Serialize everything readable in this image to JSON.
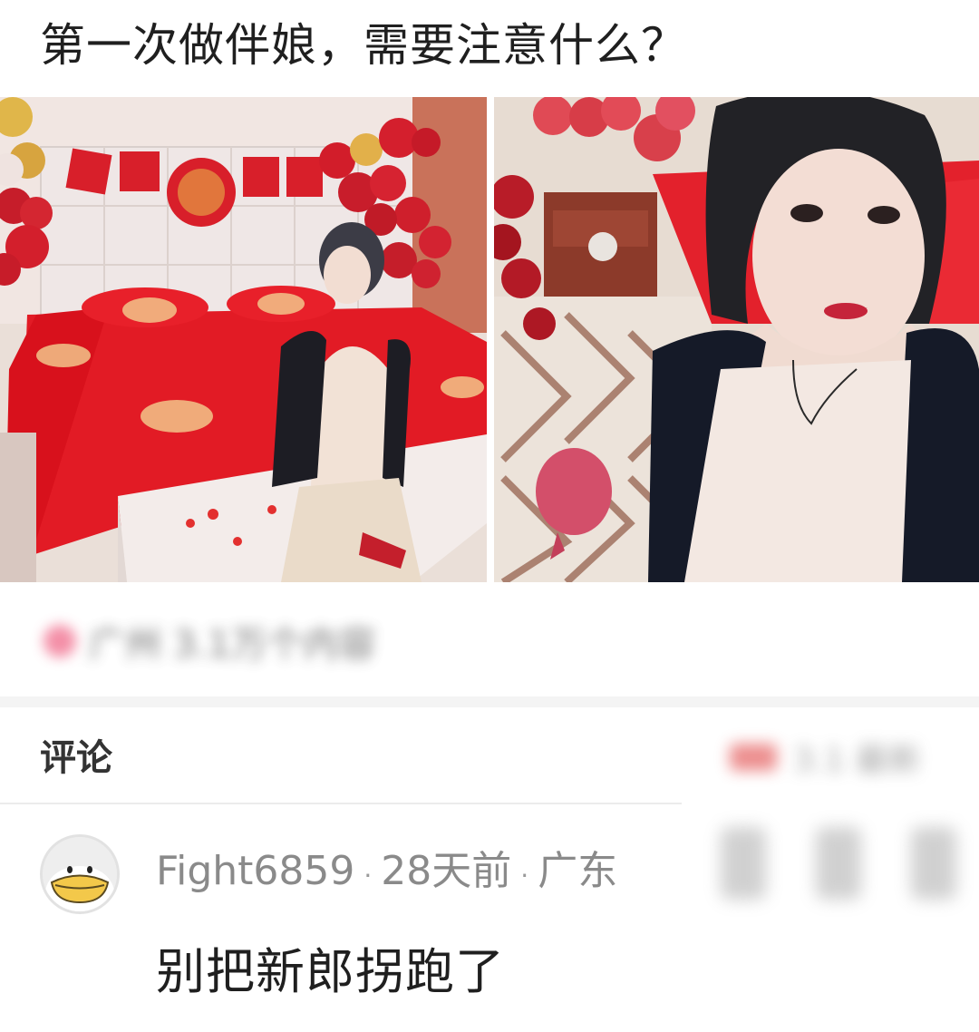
{
  "post": {
    "title": "第一次做伴娘，需要注意什么？"
  },
  "location": {
    "text": "广州 3.1万个内容"
  },
  "comments": {
    "title": "评论",
    "sort_label": "3.1 最新",
    "items": [
      {
        "username": "Fight6859",
        "time": "28天前",
        "region": "广东",
        "text": "别把新郎拐跑了"
      }
    ]
  },
  "colors": {
    "accent_red": "#d62b2b",
    "bed_red": "#e21b25",
    "text_dark": "#1f1f1f",
    "text_meta": "#8a8a8a"
  }
}
